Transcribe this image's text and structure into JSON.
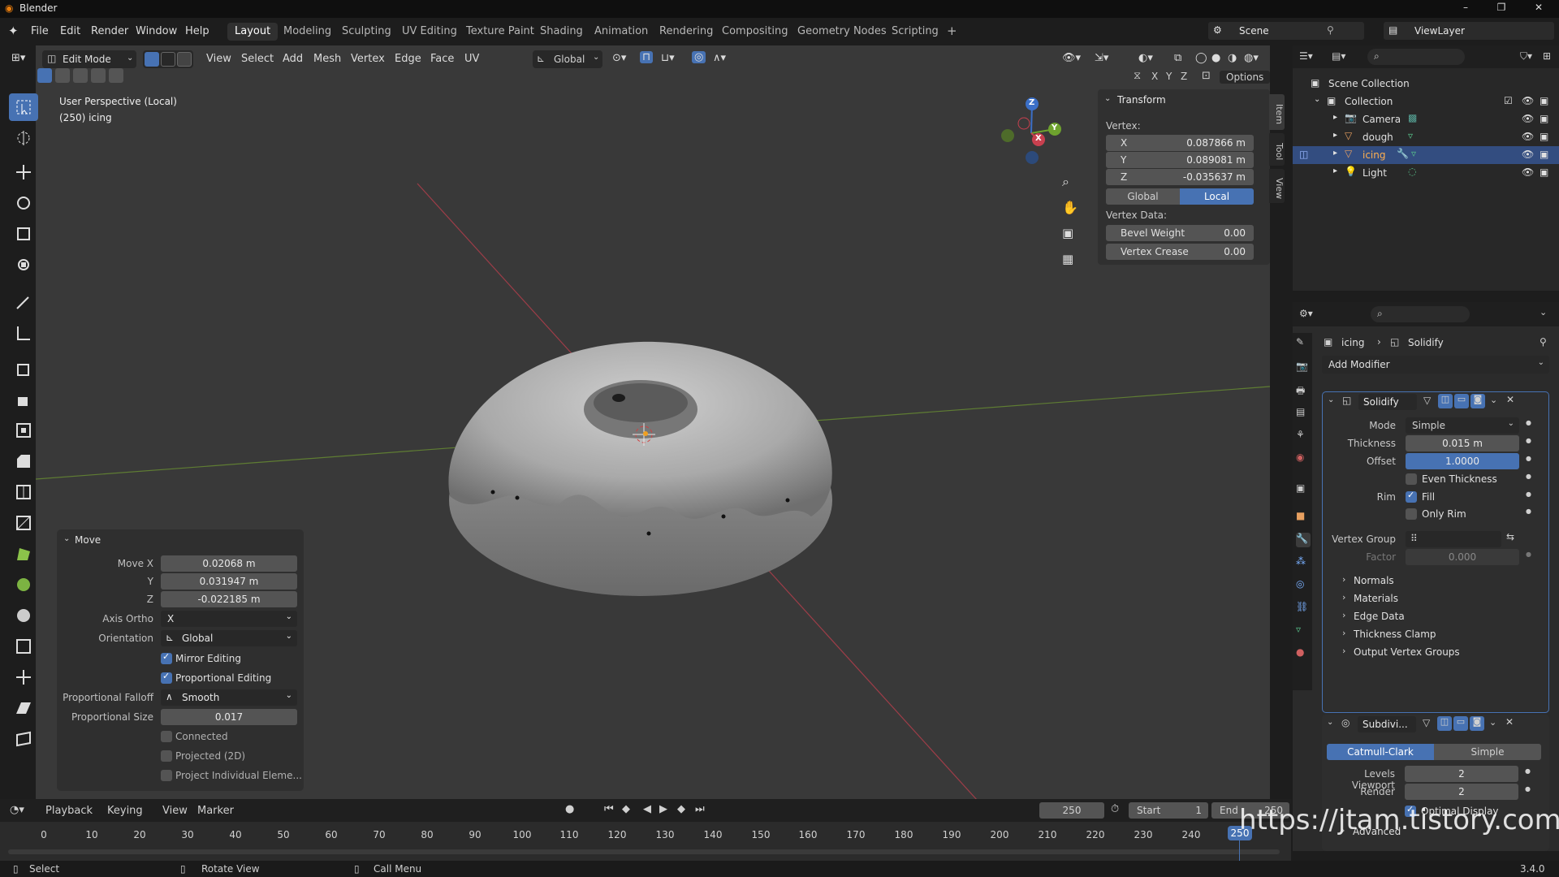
{
  "app_title": "Blender",
  "menu": [
    "File",
    "Edit",
    "Render",
    "Window",
    "Help"
  ],
  "workspaces": [
    "Layout",
    "Modeling",
    "Sculpting",
    "UV Editing",
    "Texture Paint",
    "Shading",
    "Animation",
    "Rendering",
    "Compositing",
    "Geometry Nodes",
    "Scripting"
  ],
  "active_workspace": "Layout",
  "scene_name": "Scene",
  "view_layer": "ViewLayer",
  "viewport_header": {
    "mode": "Edit Mode",
    "menus": [
      "View",
      "Select",
      "Add",
      "Mesh",
      "Vertex",
      "Edge",
      "Face",
      "UV"
    ],
    "orientation": "Global",
    "options_label": "Options",
    "axes": [
      "X",
      "Y",
      "Z"
    ]
  },
  "viewport_overlay": {
    "perspective": "User Perspective (Local)",
    "object_info": "(250) icing"
  },
  "gizmo": {
    "z": "Z",
    "y": "Y",
    "x": "X"
  },
  "npanel": {
    "section": "Transform",
    "vertex_label": "Vertex:",
    "x_label": "X",
    "x_value": "0.087866 m",
    "y_label": "Y",
    "y_value": "0.089081 m",
    "z_label": "Z",
    "z_value": "-0.035637 m",
    "global_label": "Global",
    "local_label": "Local",
    "vertex_data_label": "Vertex Data:",
    "bevel_label": "Bevel Weight",
    "bevel_value": "0.00",
    "crease_label": "Vertex Crease",
    "crease_value": "0.00",
    "tabs": [
      "Item",
      "Tool",
      "View"
    ]
  },
  "move_panel": {
    "title": "Move",
    "move_x_label": "Move X",
    "move_x": "0.02068 m",
    "y_label": "Y",
    "y": "0.031947 m",
    "z_label": "Z",
    "z": "-0.022185 m",
    "axis_ortho_label": "Axis Ortho",
    "axis_ortho": "X",
    "orientation_label": "Orientation",
    "orientation": "Global",
    "mirror_editing": "Mirror Editing",
    "proportional_editing": "Proportional Editing",
    "falloff_label": "Proportional Falloff",
    "falloff": "Smooth",
    "size_label": "Proportional Size",
    "size": "0.017",
    "connected": "Connected",
    "projected": "Projected (2D)",
    "project_individual": "Project Individual Eleme..."
  },
  "outliner": {
    "scene_collection": "Scene Collection",
    "collection": "Collection",
    "items": [
      "Camera",
      "dough",
      "icing",
      "Light"
    ],
    "selected": "icing"
  },
  "properties": {
    "breadcrumb_object": "icing",
    "breadcrumb_modifier": "Solidify",
    "add_modifier": "Add Modifier",
    "solidify": {
      "name": "Solidify",
      "mode_label": "Mode",
      "mode": "Simple",
      "thickness_label": "Thickness",
      "thickness": "0.015 m",
      "offset_label": "Offset",
      "offset": "1.0000",
      "even_thickness": "Even Thickness",
      "rim_label": "Rim",
      "fill": "Fill",
      "only_rim": "Only Rim",
      "vertex_group_label": "Vertex Group",
      "factor_label": "Factor",
      "factor": "0.000",
      "subpanels": [
        "Normals",
        "Materials",
        "Edge Data",
        "Thickness Clamp",
        "Output Vertex Groups"
      ]
    },
    "subdivision": {
      "name": "Subdivi...",
      "catmull": "Catmull-Clark",
      "simple": "Simple",
      "levels_label": "Levels Viewport",
      "levels": "2",
      "render_label": "Render",
      "render": "2",
      "optimal": "Optimal Display",
      "advanced": "Advanced"
    }
  },
  "timeline": {
    "menus": [
      "Playback",
      "Keying",
      "View",
      "Marker"
    ],
    "current_frame": "250",
    "start_label": "Start",
    "start": "1",
    "end_label": "End",
    "end": "250",
    "ticks": [
      "0",
      "10",
      "20",
      "30",
      "40",
      "50",
      "60",
      "70",
      "80",
      "90",
      "100",
      "110",
      "120",
      "130",
      "140",
      "150",
      "160",
      "170",
      "180",
      "190",
      "200",
      "210",
      "220",
      "230",
      "240"
    ],
    "playhead": "250"
  },
  "status": {
    "select": "Select",
    "rotate": "Rotate View",
    "call_menu": "Call Menu",
    "version": "3.4.0"
  },
  "watermark": "https://jtam.tistory.com",
  "colors": {
    "accent": "#4772b3",
    "viewport": "#393939",
    "selected_row": "#334d80",
    "x_axis": "#c8404f",
    "y_axis": "#6ea22e"
  }
}
